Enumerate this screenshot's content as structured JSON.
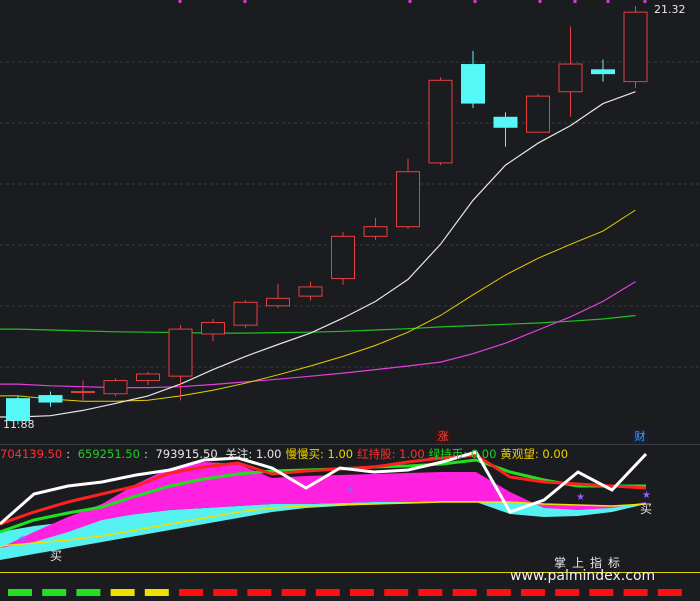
{
  "price_chart": {
    "high_label": "21.32",
    "low_label": "11.88",
    "up_tag": "涨",
    "fin_tag": "财"
  },
  "indicator_legend": {
    "v1": "704139.50",
    "v2": "659251.50",
    "v3": "793915.50",
    "items": [
      {
        "text": "关注: 1.00",
        "color": "#e6e6e6"
      },
      {
        "text": "慢慢买: 1.00",
        "color": "#f0d000"
      },
      {
        "text": "红持股: 1.00",
        "color": "#ff3030"
      },
      {
        "text": "绿持币: 0.00",
        "color": "#20d020"
      },
      {
        "text": "黄观望: 0.00",
        "color": "#f0d000"
      }
    ]
  },
  "signals": {
    "buy1": "买",
    "buy2": "买"
  },
  "watermark": {
    "brand": "掌上指标",
    "url": "www.palmindex.com"
  },
  "colors": {
    "up_candle": "#e84040",
    "down_candle": "#55f7f7",
    "ma_white": "#e6e6e6",
    "ma_yellow": "#e6d000",
    "ma_magenta": "#e040e0",
    "ma_green": "#20c020"
  },
  "chart_data": {
    "type": "candlestick",
    "candles": [
      {
        "o": 12.4,
        "c": 11.88,
        "h": 12.45,
        "l": 11.8
      },
      {
        "o": 12.47,
        "c": 12.3,
        "h": 12.55,
        "l": 12.2
      },
      {
        "o": 12.55,
        "c": 12.55,
        "h": 12.8,
        "l": 12.35
      },
      {
        "o": 12.5,
        "c": 12.8,
        "h": 12.85,
        "l": 12.45
      },
      {
        "o": 12.8,
        "c": 12.95,
        "h": 13.0,
        "l": 12.7
      },
      {
        "o": 12.9,
        "c": 13.97,
        "h": 14.06,
        "l": 12.35
      },
      {
        "o": 13.86,
        "c": 14.12,
        "h": 14.2,
        "l": 13.7
      },
      {
        "o": 14.06,
        "c": 14.58,
        "h": 14.63,
        "l": 14.0
      },
      {
        "o": 14.5,
        "c": 14.67,
        "h": 15.0,
        "l": 14.45
      },
      {
        "o": 14.72,
        "c": 14.93,
        "h": 15.05,
        "l": 14.62
      },
      {
        "o": 15.12,
        "c": 16.08,
        "h": 16.18,
        "l": 14.98
      },
      {
        "o": 16.08,
        "c": 16.3,
        "h": 16.5,
        "l": 16.0
      },
      {
        "o": 16.3,
        "c": 17.55,
        "h": 17.85,
        "l": 16.25
      },
      {
        "o": 17.75,
        "c": 19.63,
        "h": 19.7,
        "l": 17.7
      },
      {
        "o": 20.0,
        "c": 19.1,
        "h": 20.3,
        "l": 19.0
      },
      {
        "o": 18.8,
        "c": 18.55,
        "h": 18.9,
        "l": 18.12
      },
      {
        "o": 18.45,
        "c": 19.27,
        "h": 19.32,
        "l": 18.45
      },
      {
        "o": 19.37,
        "c": 20.0,
        "h": 20.85,
        "l": 18.8
      },
      {
        "o": 19.88,
        "c": 19.77,
        "h": 20.1,
        "l": 19.6
      },
      {
        "o": 19.6,
        "c": 21.18,
        "h": 21.32,
        "l": 19.45
      }
    ],
    "ma_white": [
      11.97,
      12.0,
      12.12,
      12.28,
      12.45,
      12.72,
      13.05,
      13.35,
      13.62,
      13.88,
      14.22,
      14.6,
      15.1,
      15.9,
      16.9,
      17.7,
      18.2,
      18.6,
      19.1,
      19.37
    ],
    "ma_yellow": [
      12.45,
      12.38,
      12.33,
      12.33,
      12.35,
      12.45,
      12.58,
      12.74,
      12.93,
      13.13,
      13.35,
      13.6,
      13.9,
      14.28,
      14.75,
      15.2,
      15.58,
      15.9,
      16.2,
      16.68
    ],
    "ma_magenta": [
      12.72,
      12.68,
      12.66,
      12.64,
      12.64,
      12.66,
      12.71,
      12.77,
      12.83,
      12.9,
      12.97,
      13.05,
      13.13,
      13.22,
      13.41,
      13.65,
      13.95,
      14.25,
      14.6,
      15.05
    ],
    "ma_green": [
      13.97,
      13.95,
      13.93,
      13.91,
      13.9,
      13.89,
      13.88,
      13.88,
      13.89,
      13.9,
      13.92,
      13.95,
      13.98,
      14.02,
      14.05,
      14.08,
      14.11,
      14.15,
      14.2,
      14.28
    ],
    "indicator": {
      "white_line": [
        48,
        78,
        86,
        90,
        97,
        102,
        112,
        114,
        104,
        84,
        104,
        100,
        102,
        110,
        120,
        60,
        72,
        100,
        82,
        118
      ],
      "red_line": [
        48,
        60,
        70,
        78,
        86,
        99,
        105,
        109,
        98,
        101,
        103,
        105,
        110,
        114,
        117,
        95,
        90,
        88,
        86,
        84
      ],
      "green_line": [
        40,
        52,
        59,
        65,
        76,
        86,
        93,
        98,
        101,
        102,
        103,
        105,
        106,
        108,
        112,
        100,
        92,
        86,
        86,
        86
      ],
      "yellow_line": [
        26,
        29,
        32,
        36,
        42,
        48,
        54,
        60,
        64,
        66,
        67,
        68,
        69,
        70,
        70,
        70,
        68,
        67,
        66,
        68
      ],
      "magenta_top": [
        24,
        40,
        55,
        68,
        88,
        104,
        110,
        108,
        94,
        96,
        97,
        98,
        99,
        100,
        100,
        80,
        64,
        62,
        64,
        70
      ],
      "magenta_bottom": [
        24,
        30,
        40,
        52,
        58,
        62,
        64,
        66,
        68,
        68,
        69,
        70,
        70,
        71,
        71,
        70,
        68,
        67,
        66,
        68
      ],
      "cyan_top": [
        40,
        46,
        50,
        54,
        58,
        62,
        64,
        66,
        68,
        68,
        69,
        70,
        70,
        71,
        71,
        70,
        68,
        67,
        66,
        68
      ],
      "cyan_bottom": [
        12,
        18,
        24,
        30,
        36,
        42,
        48,
        54,
        60,
        64,
        66,
        68,
        69,
        70,
        70,
        58,
        55,
        56,
        60,
        68
      ]
    },
    "signal_bars": [
      "green",
      "green",
      "green",
      "yellow",
      "yellow",
      "red",
      "red",
      "red",
      "red",
      "red",
      "red",
      "red",
      "red",
      "red",
      "red",
      "red",
      "red",
      "red",
      "red",
      "red"
    ]
  }
}
